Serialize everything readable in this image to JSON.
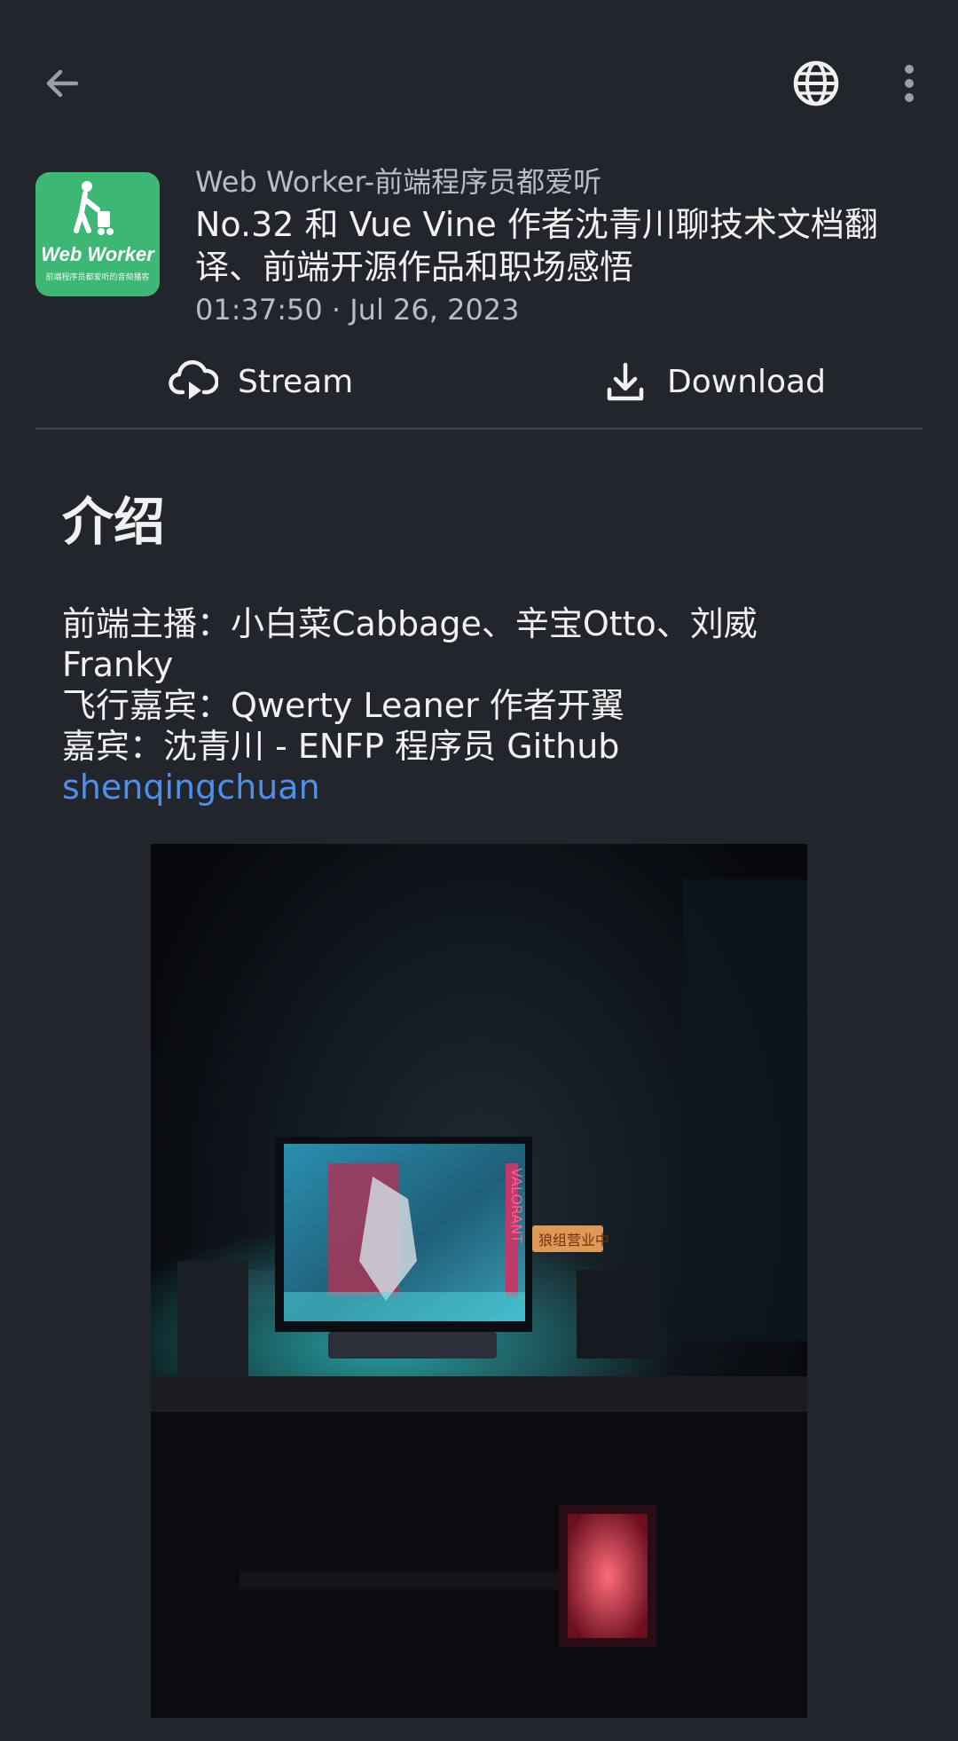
{
  "podcast": {
    "name": "Web Worker-前端程序员都爱听"
  },
  "artwork": {
    "title": "Web Worker",
    "subtitle": "前端程序员都爱听的音频播客"
  },
  "episode": {
    "title": "No.32 和 Vue Vine 作者沈青川聊技术文档翻译、前端开源作品和职场感悟",
    "duration": "01:37:50",
    "separator": " · ",
    "date": "Jul 26, 2023"
  },
  "actions": {
    "stream_label": "Stream",
    "download_label": "Download"
  },
  "description": {
    "heading": "介绍",
    "line1": "前端主播：小白菜Cabbage、辛宝Otto、刘威",
    "line2": "Franky",
    "line3": "飞行嘉宾：Qwerty Leaner 作者开翼",
    "line4": "嘉宾：沈青川 - ENFP 程序员 Github",
    "link": "shenqingchuan"
  },
  "photo_overlay": {
    "monitor_text": "VALORANT",
    "sign_text": "狼组营业中"
  },
  "icons": {
    "back": "arrow-left-icon",
    "globe": "globe-icon",
    "more": "more-vertical-icon",
    "stream": "cloud-play-icon",
    "download": "download-icon"
  },
  "colors": {
    "background": "#22262c",
    "accent_link": "#4f8fea",
    "artwork_green": "#3cb774"
  }
}
